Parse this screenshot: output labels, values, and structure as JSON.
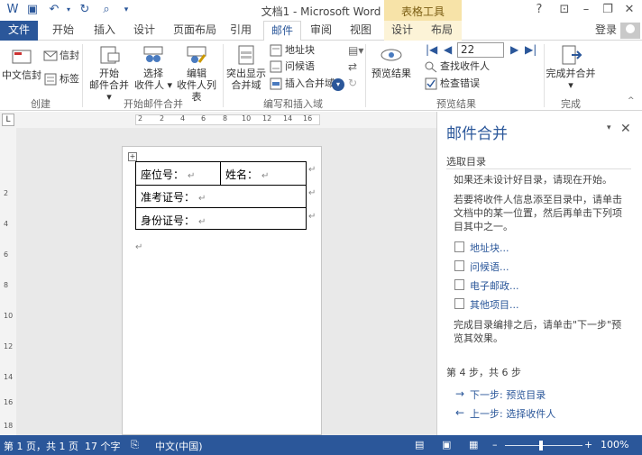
{
  "window": {
    "title": "文档1 - Microsoft Word",
    "contextual_group": "表格工具",
    "help": "?",
    "login": "登录"
  },
  "tabs": [
    "文件",
    "开始",
    "插入",
    "设计",
    "页面布局",
    "引用",
    "邮件",
    "审阅",
    "视图",
    "设计",
    "布局"
  ],
  "active_tab": "邮件",
  "ribbon": {
    "create": {
      "label": "创建",
      "chinese_envelope": "中文信封",
      "envelope": "信封",
      "labels": "标签"
    },
    "start": {
      "label": "开始邮件合并",
      "start_merge": [
        "开始",
        "邮件合并 ▾"
      ],
      "select_recipients": [
        "选择",
        "收件人 ▾"
      ],
      "edit_list": [
        "编辑",
        "收件人列表"
      ]
    },
    "fields": {
      "label": "编写和插入域",
      "highlight": [
        "突出显示",
        "合并域"
      ],
      "address_block": "地址块",
      "greeting": "问候语",
      "insert_field": "插入合并域 ▾"
    },
    "preview": {
      "label": "预览结果",
      "preview_results": "预览结果",
      "record": "22",
      "find_recipient": "查找收件人",
      "check_errors": "检查错误"
    },
    "finish": {
      "label": "完成",
      "finish_merge": [
        "完成并合并",
        "▾"
      ]
    }
  },
  "ruler": {
    "ticks": [
      "2",
      "2",
      "4",
      "6",
      "8",
      "10",
      "12",
      "14",
      "16"
    ],
    "vticks": [
      "2",
      "4",
      "6",
      "8",
      "10",
      "12",
      "14",
      "16",
      "18"
    ]
  },
  "document": {
    "seat_label": "座位号：",
    "name_label": "姓名：",
    "exam_label": "准考证号：",
    "id_label": "身份证号："
  },
  "pane": {
    "title": "邮件合并",
    "section": "选取目录",
    "intro": "如果还未设计好目录，请现在开始。",
    "instructions": "若要将收件人信息添至目录中，请单击文档中的某一位置，然后再单击下列项目其中之一。",
    "links": [
      "地址块...",
      "问候语...",
      "电子邮政...",
      "其他项目..."
    ],
    "after": "完成目录编排之后，请单击\"下一步\"预览其效果。",
    "step": "第 4 步，共 6 步",
    "next": "下一步: 预览目录",
    "prev": "上一步: 选择收件人"
  },
  "status": {
    "page": "第 1 页，共 1 页",
    "words": "17 个字",
    "language": "中文(中国)",
    "zoom": "100%"
  },
  "colors": {
    "accent": "#2b579a",
    "table_tools": "#f7e3a8"
  }
}
